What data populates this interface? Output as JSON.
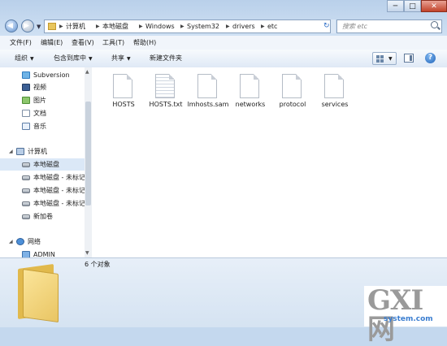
{
  "window": {
    "controls": {
      "minimize": "─",
      "maximize": "□",
      "close": "✕"
    }
  },
  "nav": {
    "back": "◀",
    "forward": "▶"
  },
  "address": {
    "crumbs": [
      "计算机",
      "本地磁盘",
      "Windows",
      "System32",
      "drivers",
      "etc"
    ],
    "refresh": "↻"
  },
  "search": {
    "placeholder": "搜索 etc"
  },
  "menubar": {
    "items": [
      "文件(F)",
      "编辑(E)",
      "查看(V)",
      "工具(T)",
      "帮助(H)"
    ]
  },
  "toolbar": {
    "organize": "组织",
    "include_in_library": "包含到库中",
    "share": "共享",
    "new_folder": "新建文件夹",
    "help": "?"
  },
  "sidebar": {
    "items": [
      {
        "label": "Subversion",
        "icon": "subversion-icon"
      },
      {
        "label": "视频",
        "icon": "video-icon"
      },
      {
        "label": "图片",
        "icon": "pictures-icon"
      },
      {
        "label": "文档",
        "icon": "documents-icon"
      },
      {
        "label": "音乐",
        "icon": "music-icon"
      },
      {
        "label": "计算机",
        "icon": "computer-icon"
      },
      {
        "label": "本地磁盘",
        "icon": "drive-icon"
      },
      {
        "label": "本地磁盘 - 未标记",
        "icon": "drive-icon"
      },
      {
        "label": "本地磁盘 - 未标记",
        "icon": "drive-icon"
      },
      {
        "label": "本地磁盘 - 未标记",
        "icon": "drive-icon"
      },
      {
        "label": "新加卷",
        "icon": "drive-icon"
      },
      {
        "label": "网络",
        "icon": "network-icon"
      },
      {
        "label": "ADMIN",
        "icon": "computer-icon"
      }
    ]
  },
  "files": [
    {
      "name": "HOSTS",
      "type": "file"
    },
    {
      "name": "HOSTS.txt",
      "type": "text"
    },
    {
      "name": "lmhosts.sam",
      "type": "file"
    },
    {
      "name": "networks",
      "type": "file"
    },
    {
      "name": "protocol",
      "type": "file"
    },
    {
      "name": "services",
      "type": "file"
    }
  ],
  "details": {
    "count": "6 个对象"
  },
  "watermark": {
    "brand": "GXI网",
    "domain": "system.com"
  },
  "colors": {
    "accent": "#2a6bc5",
    "selection": "#dbe8f7",
    "folder": "#e9c563"
  }
}
